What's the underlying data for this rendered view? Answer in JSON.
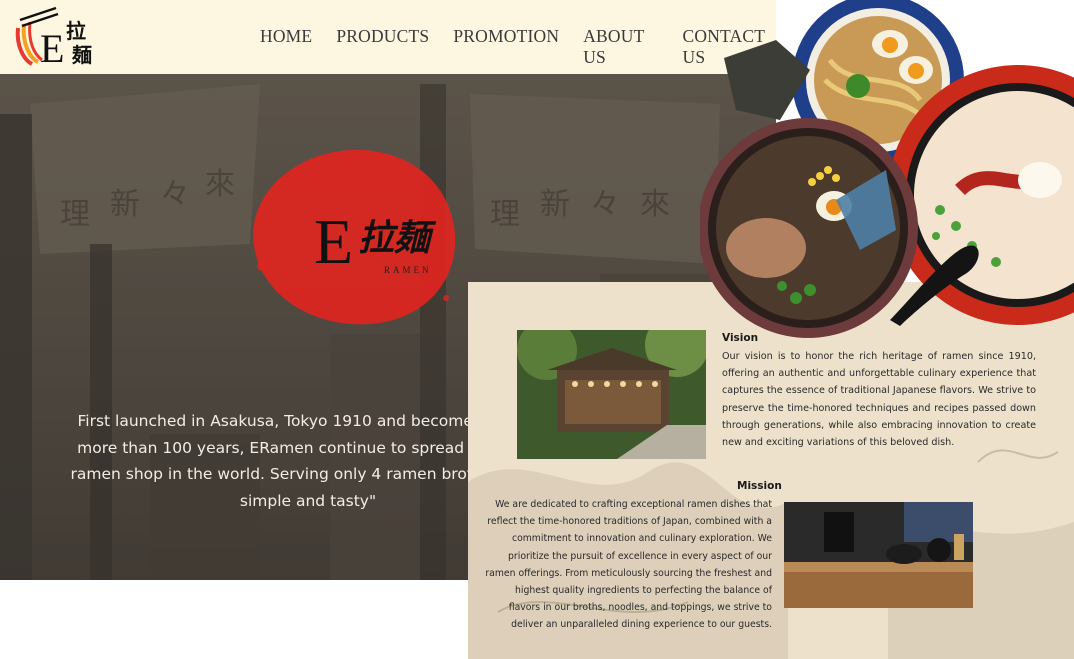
{
  "header": {
    "logo_alt": "E拉麺",
    "nav": [
      {
        "label": "HOME"
      },
      {
        "label": "PRODUCTS"
      },
      {
        "label": "PROMOTION"
      },
      {
        "label": "ABOUT US"
      },
      {
        "label": "CONTACT US"
      }
    ]
  },
  "hero": {
    "brand": {
      "latin": "E",
      "kanji": "拉麺",
      "sub": "RAMEN"
    },
    "text": "First launched in Asakusa, Tokyo 1910 and become the first\nmore than 100 years, ERamen continue to spread overseas\nramen shop in the world. Serving only 4 ramen broths, ERam\nsimple and tasty\""
  },
  "vision": {
    "title": "Vision",
    "body": "Our vision is to honor the rich heritage of ramen since 1910, offering an authentic and unforgettable culinary experience that captures the essence of traditional Japanese flavors. We strive to preserve the time-honored techniques and recipes passed down through generations, while also embracing innovation to create new and exciting variations of this beloved dish."
  },
  "mission": {
    "title": "Mission",
    "body": "We are dedicated to crafting exceptional ramen dishes that reflect the time-honored traditions of Japan, combined with a commitment to innovation and culinary exploration. We prioritize the pursuit of excellence in every aspect of our ramen offerings. From meticulously sourcing the freshest and highest quality ingredients to perfecting the balance of flavors in our broths, noodles, and toppings, we strive to deliver an unparalleled dining experience to our guests."
  },
  "colors": {
    "header_bg": "#fdf6e1",
    "panel_bg": "#ede1cc",
    "brand_red": "#e0251f",
    "nav_text": "#3a3a3a"
  },
  "icons": [
    "ramen-logo-icon",
    "ink-circle-icon"
  ]
}
